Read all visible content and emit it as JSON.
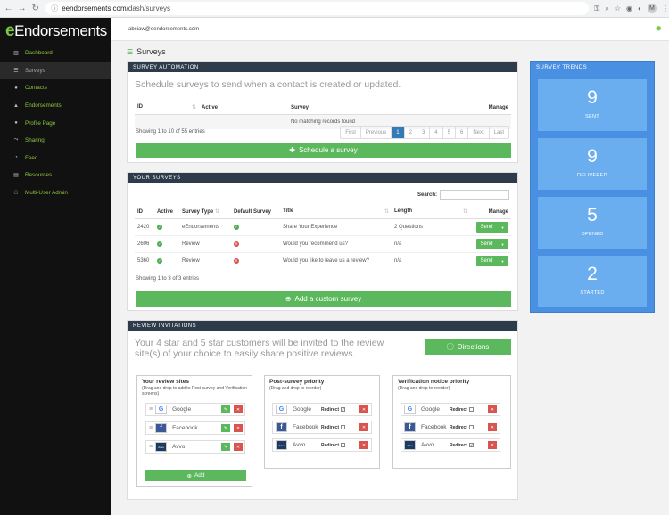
{
  "browser": {
    "url_domain": "eendorsements.com",
    "url_path": "/dash/surveys",
    "avatar": "M"
  },
  "logo": {
    "prefix": "e",
    "name": "Endorsements"
  },
  "sidebar": {
    "items": [
      {
        "label": "Dashboard",
        "icon": "bar-chart-icon"
      },
      {
        "label": "Surveys",
        "icon": "list-icon"
      },
      {
        "label": "Contacts",
        "icon": "user-icon"
      },
      {
        "label": "Endorsements",
        "icon": "thumbs-up-icon"
      },
      {
        "label": "Profile Page",
        "icon": "user-icon"
      },
      {
        "label": "Sharing",
        "icon": "share-icon"
      },
      {
        "label": "Feed",
        "icon": "rss-icon"
      },
      {
        "label": "Resources",
        "icon": "book-icon"
      },
      {
        "label": "Multi-User Admin",
        "icon": "users-icon"
      }
    ]
  },
  "topbar": {
    "email": "abciaw@eendorsements.com"
  },
  "page": {
    "title": "Surveys"
  },
  "automation": {
    "header": "SURVEY AUTOMATION",
    "intro": "Schedule surveys to send when a contact is created or updated.",
    "cols": {
      "id": "ID",
      "active": "Active",
      "survey": "Survey",
      "manage": "Manage"
    },
    "empty": "No matching records found",
    "info": "Showing 1 to 10 of 55 entries",
    "pagination": [
      "First",
      "Previous",
      "1",
      "2",
      "3",
      "4",
      "5",
      "6",
      "Next",
      "Last"
    ],
    "button": "Schedule a survey"
  },
  "your_surveys": {
    "header": "YOUR SURVEYS",
    "search_label": "Search:",
    "cols": {
      "id": "ID",
      "active": "Active",
      "type": "Survey Type",
      "default": "Default Survey",
      "title": "Title",
      "length": "Length",
      "manage": "Manage"
    },
    "rows": [
      {
        "id": "2420",
        "active": true,
        "type": "eEndorsements",
        "default": true,
        "title": "Share Your Experience",
        "length": "2 Questions",
        "action": "Send"
      },
      {
        "id": "2606",
        "active": true,
        "type": "Review",
        "default": false,
        "title": "Would you recommend us?",
        "length": "n/a",
        "action": "Send"
      },
      {
        "id": "5360",
        "active": true,
        "type": "Review",
        "default": false,
        "title": "Would you like to leave us a review?",
        "length": "n/a",
        "action": "Send"
      }
    ],
    "info": "Showing 1 to 3 of 3 entries",
    "button": "Add a custom survey"
  },
  "trends": {
    "header": "SURVEY TRENDS",
    "stats": [
      {
        "value": "9",
        "label": "SENT"
      },
      {
        "value": "9",
        "label": "DELIVERED"
      },
      {
        "value": "5",
        "label": "OPENED"
      },
      {
        "value": "2",
        "label": "STARTED"
      }
    ]
  },
  "review": {
    "header": "REVIEW INVITATIONS",
    "intro": "Your 4 star and 5 star customers will be invited to the review site(s) of your choice to easily share positive reviews.",
    "directions": "Directions",
    "sites": {
      "title": "Your review sites",
      "sub": "(Drag and drop to add to Post-survey and Verification screens)",
      "items": [
        "Google",
        "Facebook",
        "Avvo"
      ],
      "add": "Add"
    },
    "post": {
      "title": "Post-survey priority",
      "sub": "(Drag and drop to reorder)",
      "items": [
        {
          "name": "Google",
          "redirect": true
        },
        {
          "name": "Facebook",
          "redirect": false
        },
        {
          "name": "Avvo",
          "redirect": false
        }
      ]
    },
    "verify": {
      "title": "Verification notice priority",
      "sub": "(Drag and drop to reorder)",
      "items": [
        {
          "name": "Google",
          "redirect": false
        },
        {
          "name": "Facebook",
          "redirect": false
        },
        {
          "name": "Avvo",
          "redirect": true
        }
      ]
    },
    "redirect_label": "Redirect"
  },
  "colors": {
    "accent": "#7ac943",
    "header": "#2e3b4b",
    "trend": "#4a90e2",
    "success": "#5cb85c",
    "danger": "#d9534f"
  }
}
